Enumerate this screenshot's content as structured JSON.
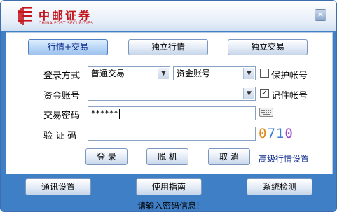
{
  "title": {
    "brand_cn": "中邮证券",
    "brand_en": "CHINA POST SECURITIES",
    "close_label": "×"
  },
  "mode_buttons": [
    {
      "label": "行情+交易",
      "selected": true
    },
    {
      "label": "独立行情",
      "selected": false
    },
    {
      "label": "独立交易",
      "selected": false
    }
  ],
  "form": {
    "login_method_label": "登录方式",
    "login_method_value": "普通交易",
    "account_type_value": "资金账号",
    "protect_account_label": "保护帐号",
    "protect_account_checked": false,
    "fund_account_label": "资金账号",
    "fund_account_value": "",
    "remember_account_label": "记住帐号",
    "remember_account_checked": true,
    "password_label": "交易密码",
    "password_value": "******",
    "captcha_label": "验 证 码",
    "captcha_input_value": "",
    "captcha_chars": [
      "0",
      "7",
      "1",
      "0"
    ]
  },
  "actions": {
    "login": "登 录",
    "offline": "脱 机",
    "cancel": "取 消",
    "advanced_link": "高级行情设置"
  },
  "footer_buttons": {
    "comm_settings": "通讯设置",
    "user_guide": "使用指南",
    "system_check": "系统检测"
  },
  "status_text": "请输入密码信息!",
  "colors": {
    "frame_blue": "#3f7fc6",
    "brand_red": "#c4161c",
    "link_blue": "#0b2a8c"
  }
}
